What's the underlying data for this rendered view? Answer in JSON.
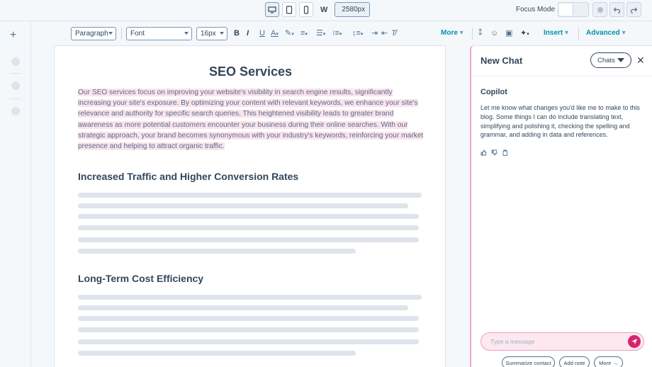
{
  "topbar": {
    "width_label": "W",
    "width_value": "2580px",
    "focus_mode_label": "Focus Mode"
  },
  "toolbar": {
    "paragraph_select": "Paragraph",
    "font_select": "Font",
    "size_select": "16px",
    "bold": "B",
    "italic": "I",
    "underline": "U",
    "more_label": "More",
    "insert_label": "Insert",
    "advanced_label": "Advanced"
  },
  "editor": {
    "title": "SEO Services",
    "intro": "Our SEO services focus on improving your website's visibility in search engine results, significantly increasing your site's exposure. By optimizing your content with relevant keywords, we enhance your site's relevance and authority for specific search queries. This heightened visibility leads to greater brand awareness as more potential customers encounter your business during their online searches. With our strategic approach, your brand becomes synonymous with your industry's keywords, reinforcing your market presence and helping to attract organic traffic.",
    "section1_heading": "Increased Traffic and Higher Conversion Rates",
    "section2_heading": "Long-Term Cost Efficiency"
  },
  "chat": {
    "title": "New Chat",
    "chats_button": "Chats",
    "assistant_name": "Copilot",
    "assistant_message": "Let me know what changes you'd like me to make to this blog. Some things I can do include translating text, simplifying and polishing it, checking the spelling and grammar, and adding in data and references.",
    "input_placeholder": "Type a message",
    "chips": [
      "Summarize contact",
      "Add note",
      "More →"
    ]
  },
  "colors": {
    "accent": "#0091ae",
    "send": "#d6246e",
    "highlight": "#fde3ea",
    "chat_border": "#f2a8c5"
  }
}
